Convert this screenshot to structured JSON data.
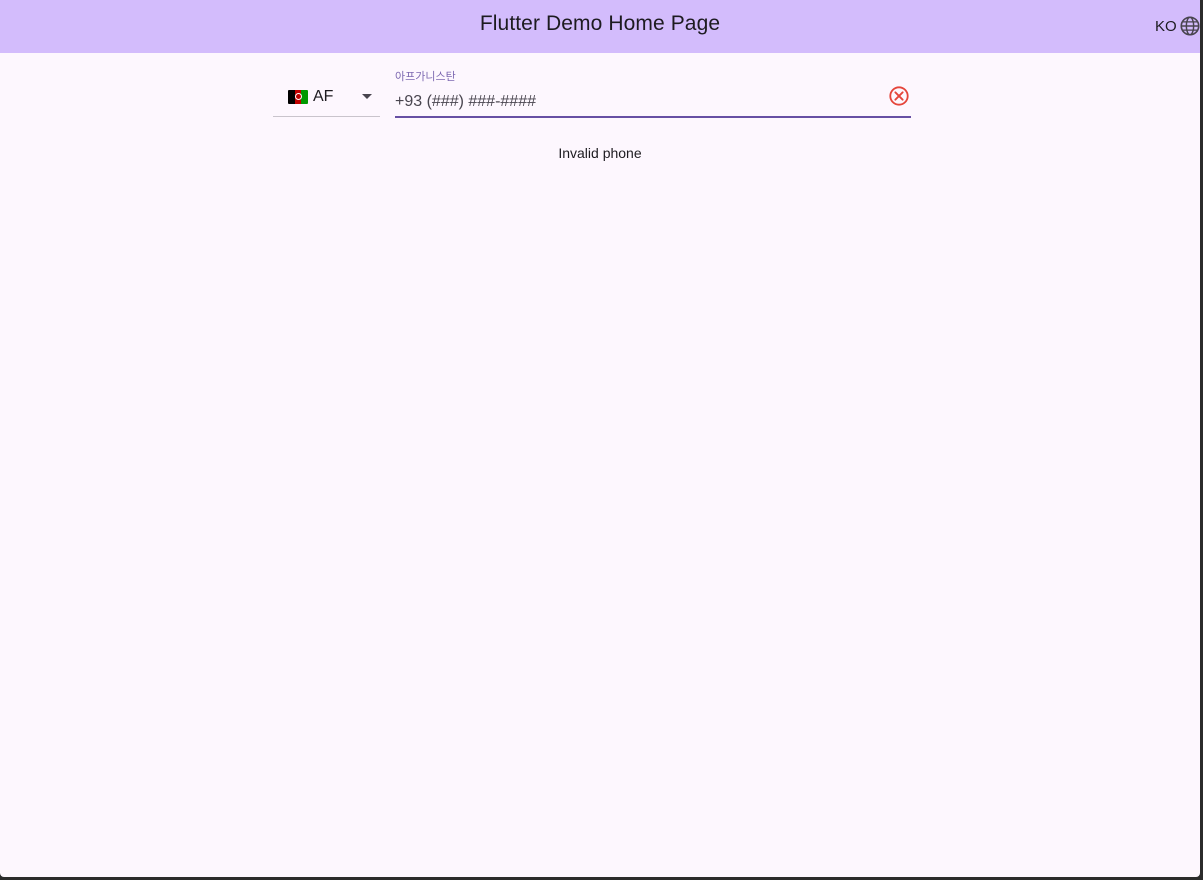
{
  "app_bar": {
    "title": "Flutter Demo Home Page",
    "background": "#d3bcfc",
    "language_button": {
      "code": "KO",
      "icon": "globe-icon"
    }
  },
  "form": {
    "country_selector": {
      "flag_icon": "afghanistan-flag-icon",
      "country_code": "AF",
      "arrow_icon": "arrow-drop-down-icon"
    },
    "phone_field": {
      "label": "아프가니스탄",
      "placeholder": "+93 (###) ###-####",
      "value": "",
      "clear_icon": "cancel-icon",
      "accent": "#6750a4",
      "clear_color": "#e5453b"
    },
    "validation_message": "Invalid phone"
  },
  "colors": {
    "background": "#fdf7fe",
    "text": "#1d1b20"
  }
}
